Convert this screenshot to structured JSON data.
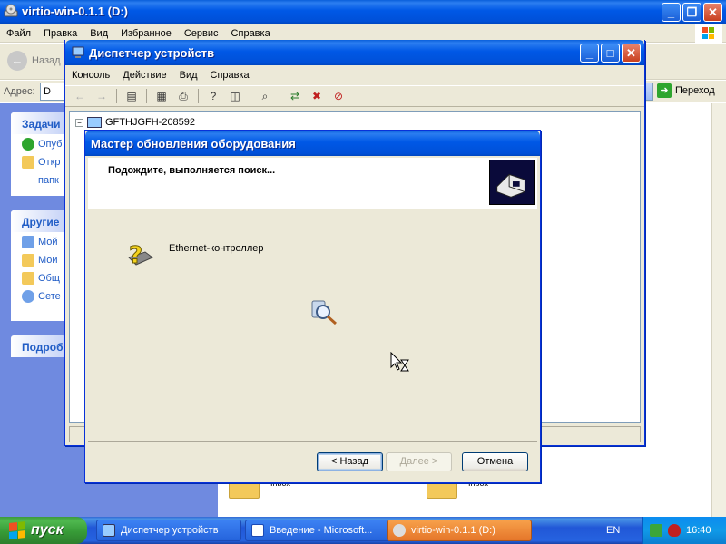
{
  "explorer": {
    "title": "virtio-win-0.1.1 (D:)",
    "menu": [
      "Файл",
      "Правка",
      "Вид",
      "Избранное",
      "Сервис",
      "Справка"
    ],
    "back_label": "Назад",
    "address_label": "Адрес:",
    "address_value": "D",
    "go_label": "Переход",
    "task_groups": [
      {
        "title": "Задачи",
        "items": [
          "Опуб",
          "Откр",
          "папк"
        ]
      },
      {
        "title": "Другие",
        "items": [
          "Мой",
          "Мои",
          "Общ",
          "Сете"
        ]
      },
      {
        "title": "Подроб",
        "items": []
      }
    ],
    "folders": [
      "Inbox",
      "Inbox"
    ]
  },
  "devmgr": {
    "title": "Диспетчер устройств",
    "menu": [
      "Консоль",
      "Действие",
      "Вид",
      "Справка"
    ],
    "tree_root": "GFTHJGFH-208592",
    "tree_toggle": "−"
  },
  "wizard": {
    "title": "Мастер обновления оборудования",
    "header": "Подождите, выполняется поиск...",
    "device_name": "Ethernet-контроллер",
    "buttons": {
      "back": "< Назад",
      "next": "Далее >",
      "cancel": "Отмена"
    }
  },
  "taskbar": {
    "start_label": "пуск",
    "tasks": [
      {
        "label": "Диспетчер устройств",
        "active": false
      },
      {
        "label": "Введение - Microsoft...",
        "active": false
      },
      {
        "label": "virtio-win-0.1.1 (D:)",
        "active": true
      }
    ],
    "language": "EN",
    "clock": "16:40"
  },
  "colors": {
    "title_blue": "#0058e6",
    "taskbar_blue": "#2157d7",
    "start_green": "#379b37",
    "active_task_orange": "#e5762a",
    "explorer_panel_blue": "#6f8ae0"
  }
}
